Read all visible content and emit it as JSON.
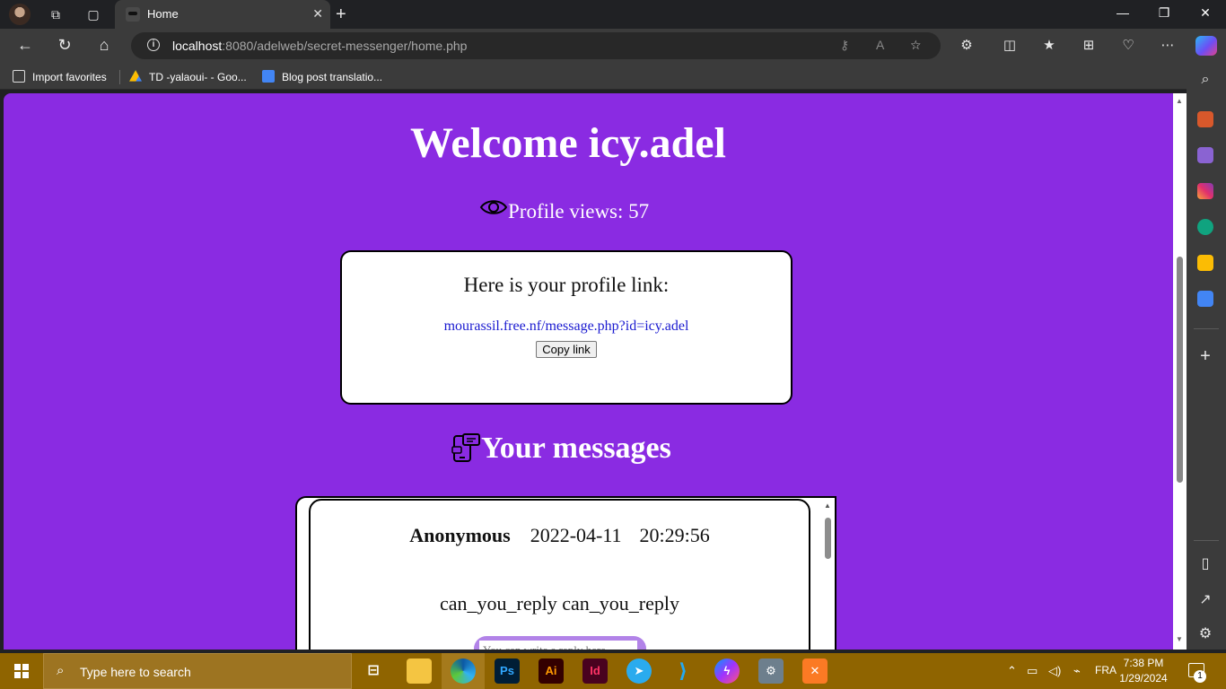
{
  "browser": {
    "tab_title": "Home",
    "url_host": "localhost",
    "url_rest": ":8080/adelweb/secret-messenger/home.php",
    "favorites": [
      {
        "label": "Import favorites"
      },
      {
        "label": "TD -yalaoui- - Goo..."
      },
      {
        "label": "Blog post translatio..."
      }
    ]
  },
  "page": {
    "welcome": "Welcome icy.adel",
    "views_label": "Profile views: ",
    "views_count": "57",
    "link_title": "Here is your profile link:",
    "profile_link": "mourassil.free.nf/message.php?id=icy.adel",
    "copy_button": "Copy link",
    "messages_title": "Your messages",
    "messages": [
      {
        "sender": "Anonymous",
        "date": "2022-04-11",
        "time": "20:29:56",
        "body": "can_you_reply can_you_reply",
        "reply_placeholder": "You can write a reply here"
      }
    ],
    "background_color": "#8a2be2"
  },
  "taskbar": {
    "search_placeholder": "Type here to search",
    "apps": [
      "file-explorer",
      "edge",
      "photoshop",
      "illustrator",
      "indesign",
      "telegram",
      "vscode",
      "messenger",
      "xampp"
    ],
    "language": "FRA",
    "time": "7:38 PM",
    "date": "1/29/2024",
    "notification_count": "1"
  }
}
